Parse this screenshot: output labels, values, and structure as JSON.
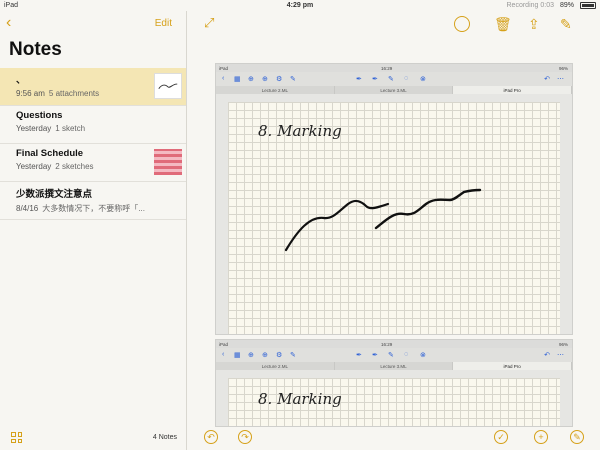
{
  "status_bar": {
    "device": "iPad",
    "time": "4:29 pm",
    "recording": "Recording 0:03",
    "battery": "89%"
  },
  "sidebar": {
    "edit_label": "Edit",
    "title": "Notes",
    "items": [
      {
        "title": "、",
        "date": "9:56 am",
        "subtitle": "5 attachments"
      },
      {
        "title": "Questions",
        "date": "Yesterday",
        "subtitle": "1 sketch"
      },
      {
        "title": "Final Schedule",
        "date": "Yesterday",
        "subtitle": "2 sketches"
      },
      {
        "title": "少数派撰文注意点",
        "date": "8/4/16",
        "subtitle": "大多数情况下，不要称呼「..."
      }
    ],
    "note_count": "4 Notes"
  },
  "inner_app": {
    "status_device": "iPad",
    "status_time": "16:29",
    "status_battery": "96%",
    "tabs": [
      "Lecture 2.ML",
      "Lecture 3.ML",
      "iPad Pro"
    ],
    "handwriting": "8. Marking"
  },
  "colors": {
    "accent": "#d6a11a",
    "selected_row": "#f4e6b4",
    "inner_accent": "#2b5fd6"
  }
}
